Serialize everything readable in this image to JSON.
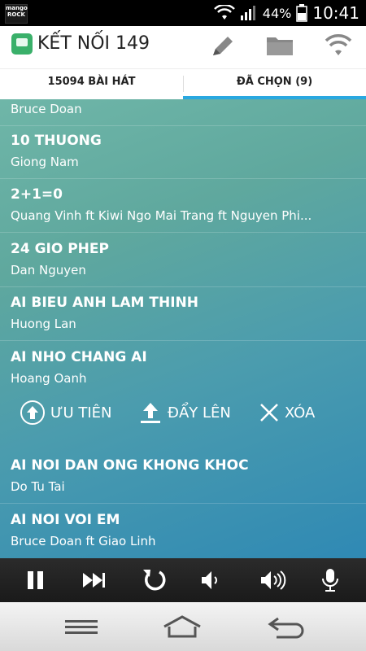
{
  "status_bar": {
    "logo_line1": "mango",
    "logo_line2": "ROCK",
    "battery": "44%",
    "time": "10:41"
  },
  "app_bar": {
    "title": "KẾT NỐI 149",
    "actions": [
      "pencil-icon",
      "folder-icon",
      "wifi-icon"
    ]
  },
  "tabs": [
    {
      "label": "15094 BÀI HÁT",
      "active": false
    },
    {
      "label": "ĐÃ CHỌN (9)",
      "active": true
    }
  ],
  "songs": [
    {
      "title": "",
      "artist": "Bruce Doan"
    },
    {
      "title": "10 THUONG",
      "artist": "Giong Nam"
    },
    {
      "title": "2+1=0",
      "artist": "Quang Vinh ft Kiwi Ngo Mai Trang ft Nguyen Phi..."
    },
    {
      "title": "24 GIO PHEP",
      "artist": "Dan Nguyen"
    },
    {
      "title": "AI BIEU ANH LAM THINH",
      "artist": "Huong Lan"
    },
    {
      "title": "AI NHO CHANG AI",
      "artist": "Hoang Oanh"
    },
    {
      "title": "AI NOI DAN ONG KHONG KHOC",
      "artist": "Do Tu Tai"
    },
    {
      "title": "AI NOI VOI EM",
      "artist": "Bruce Doan ft Giao Linh"
    }
  ],
  "song_actions": {
    "priority": "ƯU TIÊN",
    "move_up": "ĐẨY LÊN",
    "delete": "XÓA"
  },
  "player": [
    "pause-icon",
    "next-icon",
    "replay-icon",
    "volume-down-icon",
    "volume-up-icon",
    "mic-icon"
  ],
  "nav": [
    "menu-icon",
    "home-icon",
    "back-icon"
  ]
}
